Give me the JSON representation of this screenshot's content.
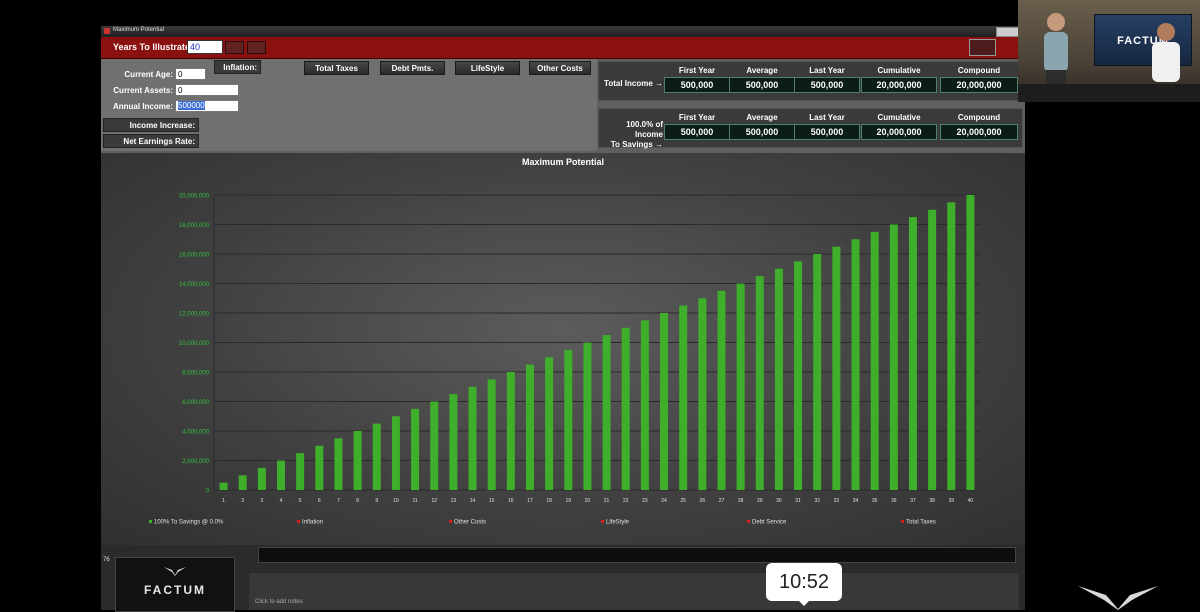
{
  "window": {
    "title": "Maximum Potential"
  },
  "redbar": {
    "years_label": "Years To Illustrate:",
    "years_value": "40"
  },
  "inputs": {
    "current_age_label": "Current Age:",
    "current_age_value": "0",
    "current_assets_label": "Current Assets:",
    "current_assets_value": "0",
    "annual_income_label": "Annual Income:",
    "annual_income_value": "500000",
    "inflation_label": "Inflation:",
    "income_increase_label": "Income Increase:",
    "net_earnings_label": "Net Earnings Rate:"
  },
  "toolbar": {
    "total_taxes": "Total Taxes",
    "debt_pmts": "Debt Pmts.",
    "lifestyle": "LifeStyle",
    "other_costs": "Other Costs"
  },
  "summary_headers": [
    "First Year",
    "Average",
    "Last Year",
    "Cumulative",
    "Compound"
  ],
  "summary1": {
    "label": "Total Income →",
    "values": [
      "500,000",
      "500,000",
      "500,000",
      "20,000,000",
      "20,000,000"
    ]
  },
  "summary2": {
    "label_line1": "100.0% of Income",
    "label_line2": "To Savings →",
    "values": [
      "500,000",
      "500,000",
      "500,000",
      "20,000,000",
      "20,000,000"
    ]
  },
  "chart_data": {
    "type": "bar",
    "title": "Maximum Potential",
    "categories": [
      "1",
      "2",
      "3",
      "4",
      "5",
      "6",
      "7",
      "8",
      "9",
      "10",
      "11",
      "12",
      "13",
      "14",
      "15",
      "16",
      "17",
      "18",
      "19",
      "20",
      "21",
      "22",
      "23",
      "24",
      "25",
      "26",
      "27",
      "28",
      "29",
      "30",
      "31",
      "32",
      "33",
      "34",
      "35",
      "36",
      "37",
      "38",
      "39",
      "40"
    ],
    "series": [
      {
        "name": "100% To Savings @ 0.0%",
        "values": [
          500000,
          1000000,
          1500000,
          2000000,
          2500000,
          3000000,
          3500000,
          4000000,
          4500000,
          5000000,
          5500000,
          6000000,
          6500000,
          7000000,
          7500000,
          8000000,
          8500000,
          9000000,
          9500000,
          10000000,
          10500000,
          11000000,
          11500000,
          12000000,
          12500000,
          13000000,
          13500000,
          14000000,
          14500000,
          15000000,
          15500000,
          16000000,
          16500000,
          17000000,
          17500000,
          18000000,
          18500000,
          19000000,
          19500000,
          20000000
        ]
      }
    ],
    "ylim": [
      0,
      20000000
    ],
    "yticks": [
      "0",
      "2,000,000",
      "4,000,000",
      "6,000,000",
      "8,000,000",
      "10,000,000",
      "12,000,000",
      "14,000,000",
      "16,000,000",
      "18,000,000",
      "20,000,000"
    ],
    "legend": [
      {
        "label": "100% To Savings @ 0.0%",
        "color": "#3fae2a"
      },
      {
        "label": "Inflation",
        "color": "#d02020"
      },
      {
        "label": "Other Costs",
        "color": "#d02020"
      },
      {
        "label": "LifeStyle",
        "color": "#d02020"
      },
      {
        "label": "Debt Service",
        "color": "#d02020"
      },
      {
        "label": "Total Taxes",
        "color": "#d02020"
      }
    ],
    "grid": true
  },
  "lower": {
    "notes_placeholder": "Click to add notes",
    "row_marker": "76",
    "thumb_brand": "FACTUM"
  },
  "timer": "10:52",
  "webcam": {
    "brand": "FACTUM"
  },
  "colors": {
    "bar": "#3fae2a",
    "value_text": "#31c43a",
    "accent_red": "#8b1111"
  }
}
